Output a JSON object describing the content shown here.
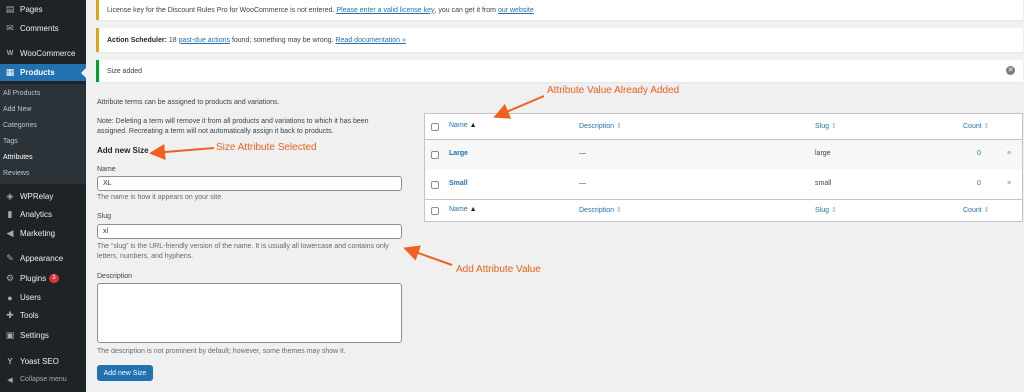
{
  "sidebar": {
    "items": [
      {
        "label": "Pages",
        "icon": "pages-icon",
        "glyph": "▤"
      },
      {
        "label": "Comments",
        "icon": "comments-icon",
        "glyph": "✉"
      },
      {
        "label": "WooCommerce",
        "icon": "woocommerce-icon",
        "glyph": "W"
      },
      {
        "label": "Products",
        "icon": "products-icon",
        "glyph": "▦"
      },
      {
        "label": "WPRelay",
        "icon": "wprelay-icon",
        "glyph": "◈"
      },
      {
        "label": "Analytics",
        "icon": "analytics-icon",
        "glyph": "▮"
      },
      {
        "label": "Marketing",
        "icon": "marketing-icon",
        "glyph": "◀"
      },
      {
        "label": "Appearance",
        "icon": "appearance-icon",
        "glyph": "✎"
      },
      {
        "label": "Plugins",
        "icon": "plugins-icon",
        "glyph": "⚙",
        "badge": "3"
      },
      {
        "label": "Users",
        "icon": "users-icon",
        "glyph": "●"
      },
      {
        "label": "Tools",
        "icon": "tools-icon",
        "glyph": "✚"
      },
      {
        "label": "Settings",
        "icon": "settings-icon",
        "glyph": "▣"
      },
      {
        "label": "Yoast SEO",
        "icon": "yoast-icon",
        "glyph": "Y"
      },
      {
        "label": "Collapse menu",
        "icon": "collapse-icon",
        "glyph": "◀"
      }
    ],
    "submenu": [
      "All Products",
      "Add New",
      "Categories",
      "Tags",
      "Attributes",
      "Reviews"
    ]
  },
  "notices": {
    "license": {
      "text": "License key for the Discount Rules Pro for WooCommerce is not entered.",
      "link1": "Please enter a valid license key",
      "mid": ", you can get it from",
      "link2": "our website"
    },
    "scheduler": {
      "label": "Action Scheduler:",
      "count": "18",
      "link1": "past-due actions",
      "mid": "found; something may be wrong.",
      "link2": "Read documentation »"
    },
    "success": {
      "text": "Size added"
    }
  },
  "form": {
    "intro": "Attribute terms can be assigned to products and variations.",
    "note": "Note: Deleting a term will remove it from all products and variations to which it has been assigned. Recreating a term will not automatically assign it back to products.",
    "heading": "Add new Size",
    "name_label": "Name",
    "name_value": "XL",
    "name_desc": "The name is how it appears on your site.",
    "slug_label": "Slug",
    "slug_value": "xl",
    "slug_desc": "The “slug” is the URL-friendly version of the name. It is usually all lowercase and contains only letters, numbers, and hyphens.",
    "description_label": "Description",
    "description_desc": "The description is not prominent by default; however, some themes may show it.",
    "submit": "Add new Size"
  },
  "table": {
    "columns": {
      "name": "Name",
      "description": "Description",
      "slug": "Slug",
      "count": "Count"
    },
    "rows": [
      {
        "name": "Large",
        "description": "—",
        "slug": "large",
        "count": "0"
      },
      {
        "name": "Small",
        "description": "—",
        "slug": "small",
        "count": "0"
      }
    ]
  },
  "annotations": {
    "already_added": "Attribute Value Already Added",
    "size_selected": "Size Attribute Selected",
    "add_value": "Add Attribute Value"
  },
  "colors": {
    "accent": "#2271b1",
    "annotation": "#f0601e",
    "sidebar": "#1d2327"
  }
}
